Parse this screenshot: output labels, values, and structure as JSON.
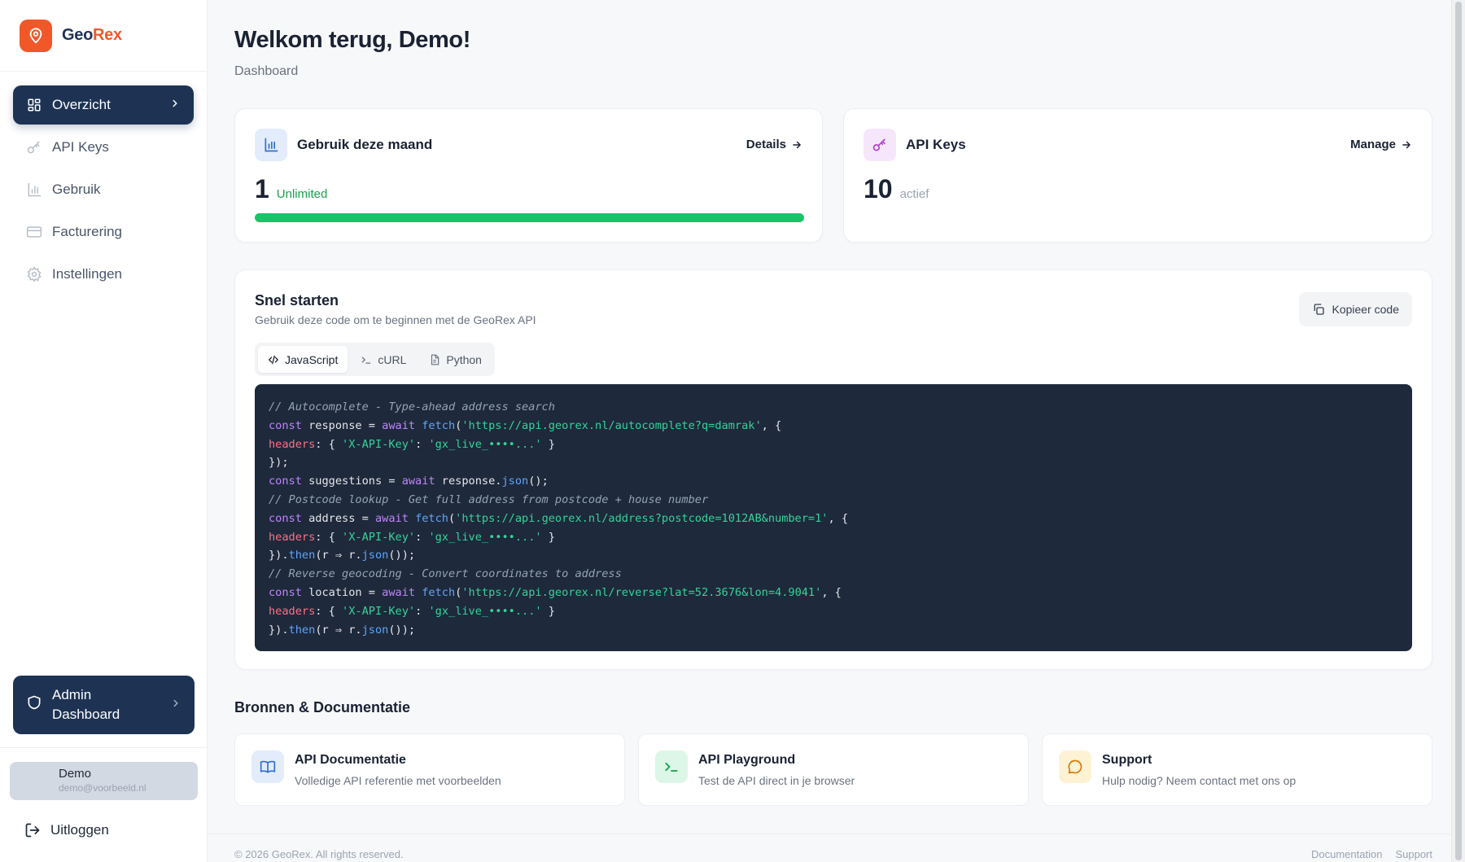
{
  "brand": {
    "name_part1": "Geo",
    "name_part2": "Rex",
    "brand_color": "#f0582a",
    "navy": "#1e3354"
  },
  "sidebar": {
    "items": [
      {
        "label": "Overzicht",
        "icon": "grid-icon",
        "active": true
      },
      {
        "label": "API Keys",
        "icon": "key-icon"
      },
      {
        "label": "Gebruik",
        "icon": "bar-chart-icon"
      },
      {
        "label": "Facturering",
        "icon": "credit-card-icon"
      },
      {
        "label": "Instellingen",
        "icon": "gear-icon"
      }
    ],
    "admin_label": "Admin Dashboard",
    "user": {
      "name": "Demo",
      "email": "demo@voorbeeld.nl"
    },
    "logout_label": "Uitloggen"
  },
  "header": {
    "title": "Welkom terug, Demo!",
    "subtitle": "Dashboard"
  },
  "usage_card": {
    "title": "Gebruik deze maand",
    "link": "Details",
    "value": "1",
    "label": "Unlimited",
    "progress": 1.0,
    "progress_color": "#16c46a",
    "label_color": "#16a34a"
  },
  "keys_card": {
    "title": "API Keys",
    "link": "Manage",
    "value": "10",
    "label": "actief"
  },
  "quickstart": {
    "title": "Snel starten",
    "subtitle": "Gebruik deze code om te beginnen met de GeoRex API",
    "copy_label": "Kopieer code",
    "tabs": [
      "JavaScript",
      "cURL",
      "Python"
    ],
    "active_tab": "JavaScript",
    "code": {
      "c1": "// Autocomplete - Type-ahead address search",
      "c2": "// Postcode lookup - Get full address from postcode + house number",
      "c3": "// Reverse geocoding - Convert coordinates to address",
      "url1": "'https://api.georex.nl/autocomplete?q=damrak'",
      "url2": "'https://api.georex.nl/address?postcode=1012AB&number=1'",
      "url3": "'https://api.georex.nl/reverse?lat=52.3676&lon=4.9041'",
      "header_key": "'X-API-Key'",
      "header_val": "'gx_live_••••...'"
    }
  },
  "resources": {
    "title": "Bronnen & Documentatie",
    "items": [
      {
        "name": "API Documentatie",
        "desc": "Volledige API referentie met voorbeelden",
        "icon": "book-icon"
      },
      {
        "name": "API Playground",
        "desc": "Test de API direct in je browser",
        "icon": "terminal-icon"
      },
      {
        "name": "Support",
        "desc": "Hulp nodig? Neem contact met ons op",
        "icon": "chat-bubble-icon"
      }
    ]
  },
  "footer": {
    "copyright": "© 2026 GeoRex. All rights reserved.",
    "links": [
      "Documentation",
      "Support"
    ]
  }
}
